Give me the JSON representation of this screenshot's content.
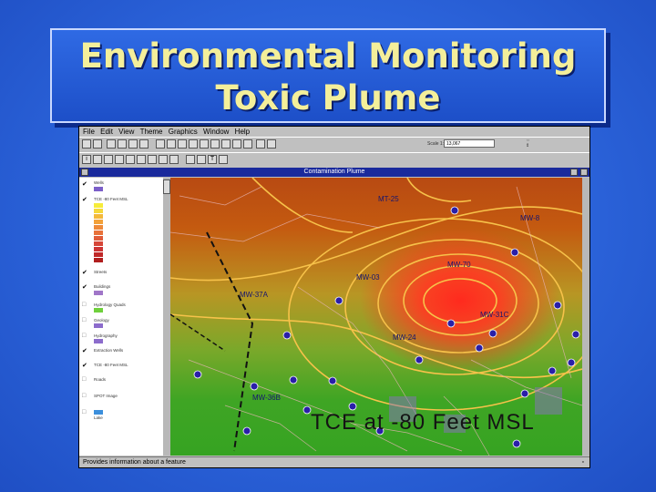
{
  "slide": {
    "title_line1": "Environmental Monitoring",
    "title_line2": "Toxic Plume",
    "colors": {
      "background": "#2a5fd6",
      "title_text": "#f4ef9a"
    }
  },
  "app": {
    "menu": [
      "File",
      "Edit",
      "View",
      "Theme",
      "Graphics",
      "Window",
      "Help"
    ],
    "scale_label": "Scale 1:",
    "scale_value": "13,067",
    "view_title": "Contamination Plume",
    "status_text": "Provides information about a feature",
    "toc": {
      "themes": [
        {
          "label": "Wells",
          "checked": true
        },
        {
          "label": "TCE -80 Feet MSL",
          "checked": true
        },
        {
          "label": "Streets",
          "checked": true
        },
        {
          "label": "Buildings",
          "checked": true
        },
        {
          "label": "Hydrology Quads",
          "checked": false
        },
        {
          "label": "Geology",
          "checked": false
        },
        {
          "label": "Hydrography",
          "checked": false
        },
        {
          "label": "Extraction Wells",
          "checked": true
        },
        {
          "label": "TCE -80 Feet MSL",
          "checked": true
        },
        {
          "label": "Roads",
          "checked": false
        },
        {
          "label": "SPOT Image",
          "checked": false
        },
        {
          "label": "Lake",
          "checked": false
        }
      ]
    },
    "map": {
      "caption": "TCE  at  -80  Feet  MSL",
      "wells": [
        {
          "label": "MT-25"
        },
        {
          "label": "MW-8"
        },
        {
          "label": "MW-70"
        },
        {
          "label": "MW-03"
        },
        {
          "label": "MW-37A"
        },
        {
          "label": "MW-31C"
        },
        {
          "label": "MW-24"
        },
        {
          "label": "MW-36B"
        }
      ]
    }
  }
}
